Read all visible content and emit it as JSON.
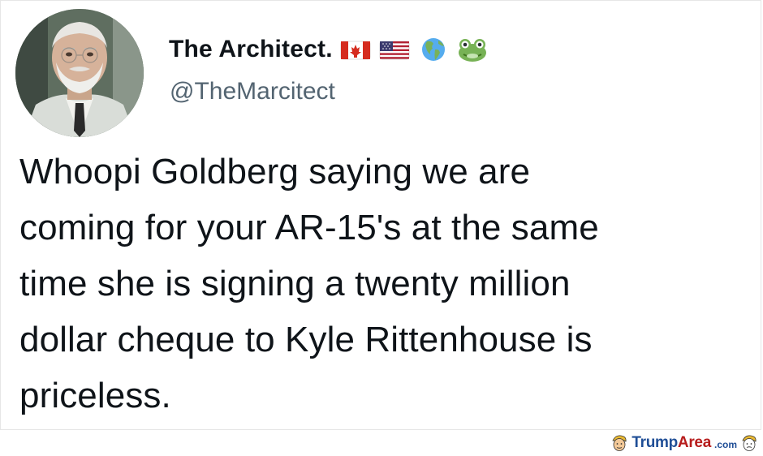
{
  "tweet": {
    "display_name": "The Architect.",
    "handle": "@TheMarcitect",
    "name_emojis": [
      "canada-flag-icon",
      "usa-flag-icon",
      "globe-americas-icon",
      "frog-icon"
    ],
    "text": "Whoopi Goldberg saying we are\ncoming for your AR-15's at the same\ntime she is signing a twenty million\ndollar cheque to Kyle Rittenhouse is\npriceless."
  },
  "watermark": {
    "brand_main": "Trump",
    "brand_area": "Area",
    "brand_tld": ".com"
  },
  "colors": {
    "text": "#0f1419",
    "handle": "#536471",
    "watermark_blue": "#1f4e96",
    "watermark_red": "#b71c1c"
  }
}
